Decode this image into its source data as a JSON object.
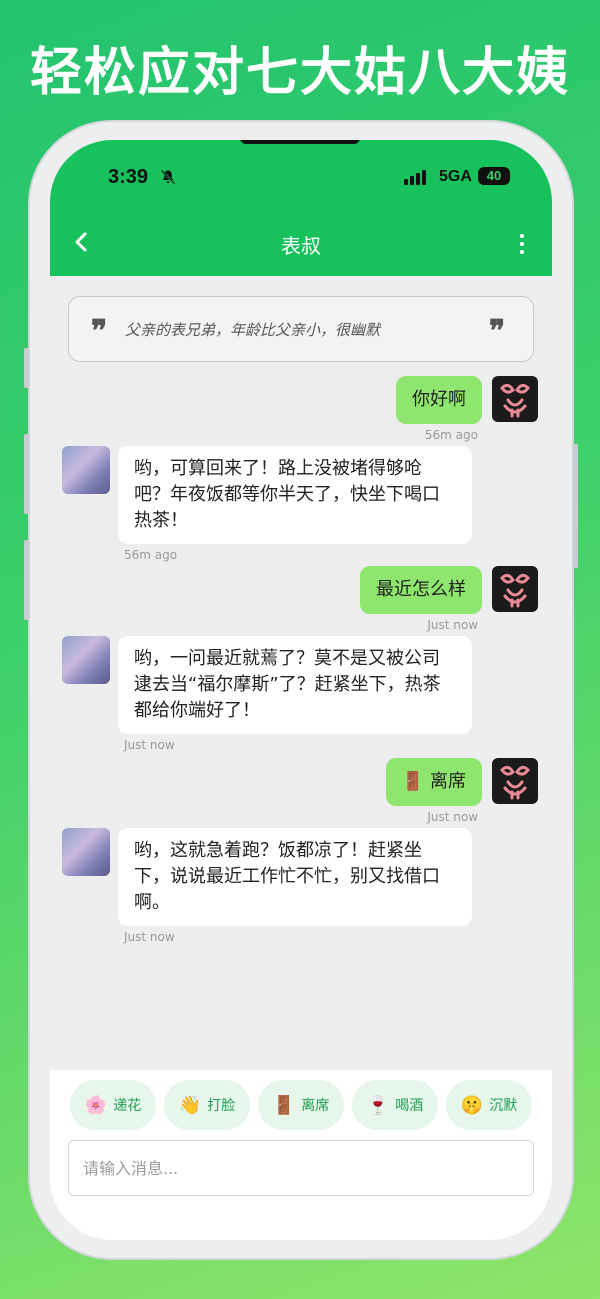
{
  "headline": "轻松应对七大姑八大姨",
  "status": {
    "time": "3:39",
    "network": "5GA",
    "battery": "40"
  },
  "header": {
    "title": "表叔",
    "back_icon": "chevron-left-icon",
    "more_icon": "more-vertical-icon"
  },
  "intro": {
    "text": "父亲的表兄弟，年龄比父亲小，很幽默",
    "open_quote": "❞",
    "close_quote": "❞"
  },
  "messages": [
    {
      "from": "me",
      "text": "你好啊",
      "time": "56m ago"
    },
    {
      "from": "bot",
      "text": "哟，可算回来了！路上没被堵得够呛吧？年夜饭都等你半天了，快坐下喝口热茶！",
      "time": "56m ago"
    },
    {
      "from": "me",
      "text": "最近怎么样",
      "time": "Just now"
    },
    {
      "from": "bot",
      "text": "哟，一问最近就蔫了？莫不是又被公司逮去当“福尔摩斯”了？赶紧坐下，热茶都给你端好了！",
      "time": "Just now"
    },
    {
      "from": "me",
      "text": "🚪 离席",
      "time": "Just now"
    },
    {
      "from": "bot",
      "text": "哟，这就急着跑？饭都凉了！赶紧坐下，说说最近工作忙不忙，别又找借口啊。",
      "time": "Just now"
    }
  ],
  "actions": [
    {
      "emoji": "🌸",
      "label": "递花"
    },
    {
      "emoji": "👋",
      "label": "打脸"
    },
    {
      "emoji": "🚪",
      "label": "离席"
    },
    {
      "emoji": "🍷",
      "label": "喝酒"
    },
    {
      "emoji": "🤫",
      "label": "沉默"
    }
  ],
  "composer": {
    "placeholder": "请输入消息..."
  },
  "colors": {
    "brand": "#17c15c",
    "bubble_me": "#8fe66e",
    "chat_bg": "#ededed",
    "chip_bg": "#e6f6ea"
  }
}
